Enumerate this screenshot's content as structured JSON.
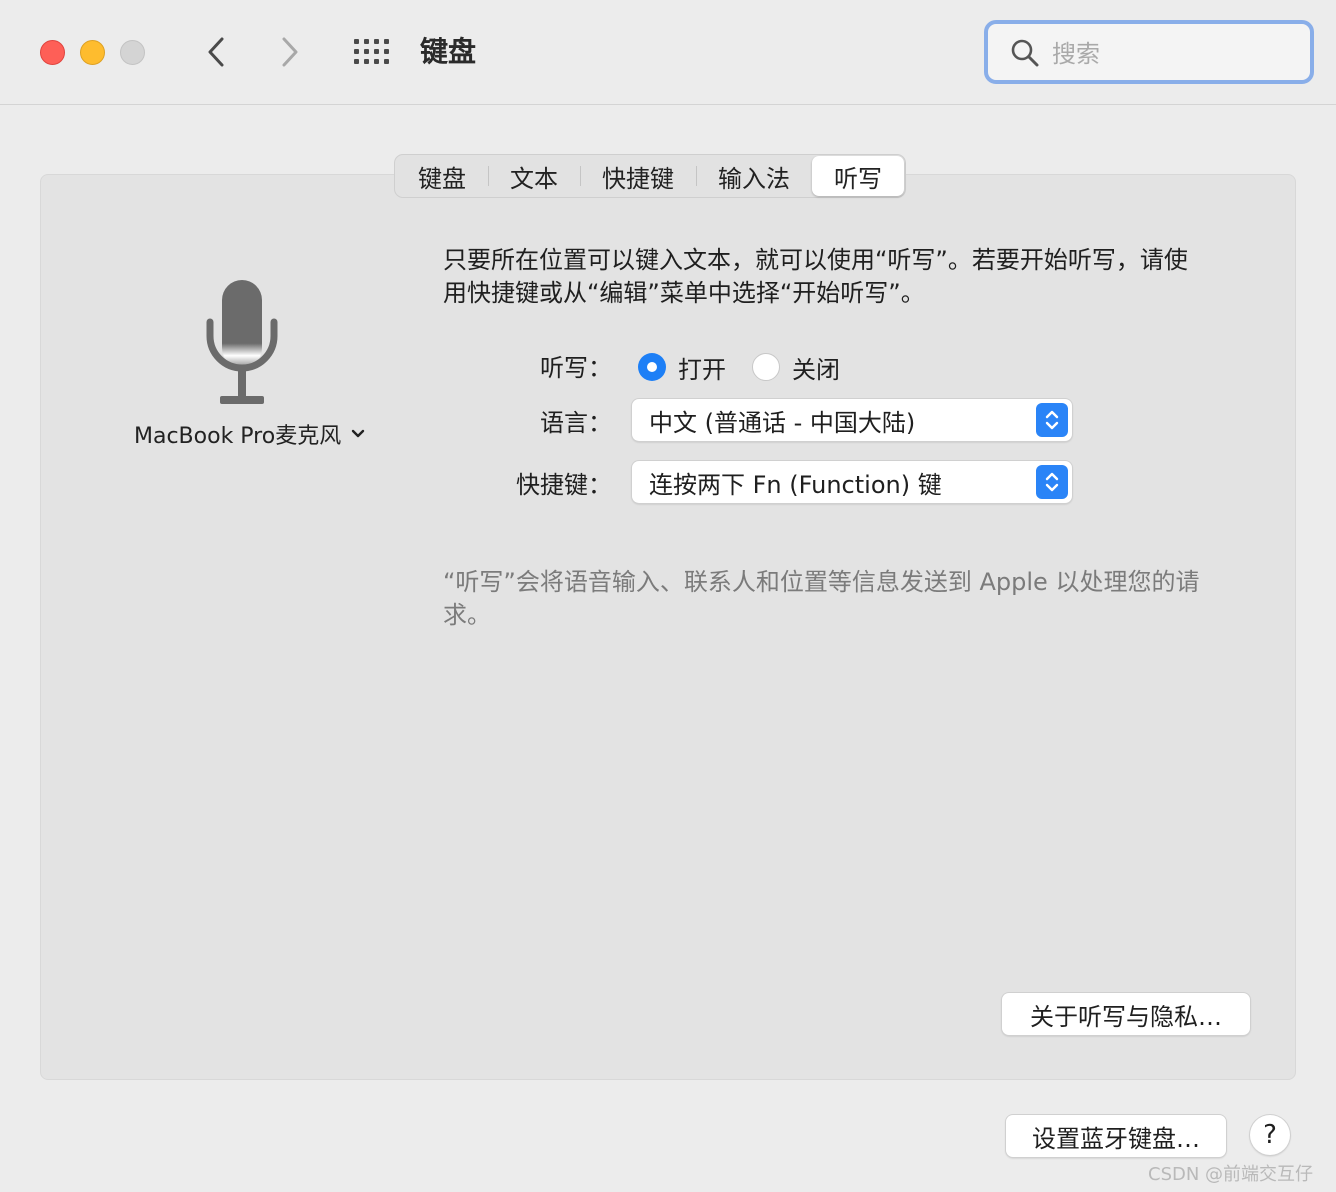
{
  "window": {
    "title": "键盘",
    "nav": {
      "back_icon": "chevron-left-icon",
      "forward_icon": "chevron-right-icon",
      "grid_icon": "grid-icon"
    }
  },
  "search": {
    "placeholder": "搜索",
    "value": ""
  },
  "tabs": [
    {
      "label": "键盘",
      "active": false
    },
    {
      "label": "文本",
      "active": false
    },
    {
      "label": "快捷键",
      "active": false
    },
    {
      "label": "输入法",
      "active": false
    },
    {
      "label": "听写",
      "active": true
    }
  ],
  "microphone": {
    "source_label": "MacBook Pro麦克风",
    "icon": "microphone-icon"
  },
  "dictation": {
    "description": "只要所在位置可以键入文本，就可以使用“听写”。若要开始听写，请使用快捷键或从“编辑”菜单中选择“开始听写”。",
    "toggle_label": "听写：",
    "on_label": "打开",
    "off_label": "关闭",
    "selected": "on",
    "language_label": "语言：",
    "language_value": "中文 (普通话 - 中国大陆)",
    "shortcut_label": "快捷键：",
    "shortcut_value": "连按两下 Fn (Function) 键",
    "privacy_note": "“听写”会将语音输入、联系人和位置等信息发送到 Apple 以处理您的请求。",
    "privacy_button": "关于听写与隐私…"
  },
  "footer": {
    "bluetooth_button": "设置蓝牙键盘…",
    "help_button": "?",
    "watermark": "CSDN @前端交互仔"
  },
  "colors": {
    "accent": "#1d7ff6",
    "close": "#fe5f57",
    "minimize": "#febc2e",
    "zoom": "#d4d4d4",
    "search_focus": "#89aee9"
  }
}
